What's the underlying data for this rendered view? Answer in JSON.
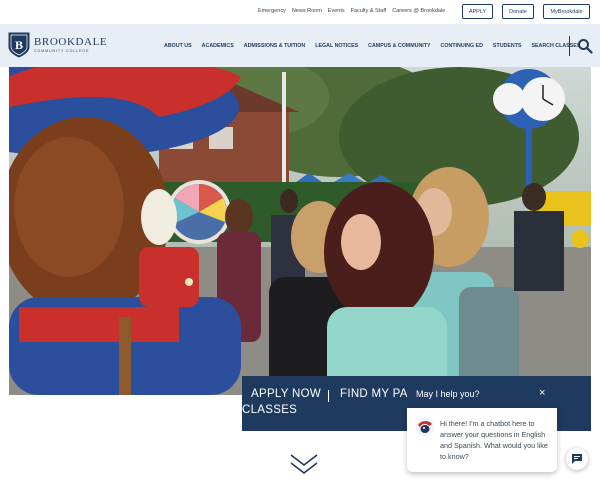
{
  "utility_bar": {
    "links": [
      "Emergency",
      "News Room",
      "Events",
      "Faculty & Staff",
      "Careers @ Brookdale"
    ],
    "buttons": [
      "APPLY",
      "Donate",
      "MyBrookdale"
    ]
  },
  "logo": {
    "name": "BROOKDALE",
    "subtitle": "COMMUNITY COLLEGE",
    "icon": "brookdale-shield-logo"
  },
  "nav": {
    "items": [
      "ABOUT US",
      "ACADEMICS",
      "ADMISSIONS & TUITION",
      "LEGAL NOTICES",
      "CAMPUS & COMMUNITY",
      "CONTINUING ED",
      "STUDENTS",
      "SEARCH CLASSES"
    ],
    "search_icon": "search-icon"
  },
  "hero": {
    "description_icon": "hero-photo"
  },
  "apply_bar": {
    "apply_now": "APPLY NOW",
    "find_my_path": "FIND MY PAT",
    "classes": "CLASSES"
  },
  "chat": {
    "title": "May I help you?",
    "close": "×",
    "message": "Hi there! I'm a chatbot here to answer your questions in English and Spanish. What would you like to know?",
    "fab_icon": "chat-icon"
  },
  "colors": {
    "navy": "#1f3a5f",
    "header_bg": "#e8eef5"
  }
}
